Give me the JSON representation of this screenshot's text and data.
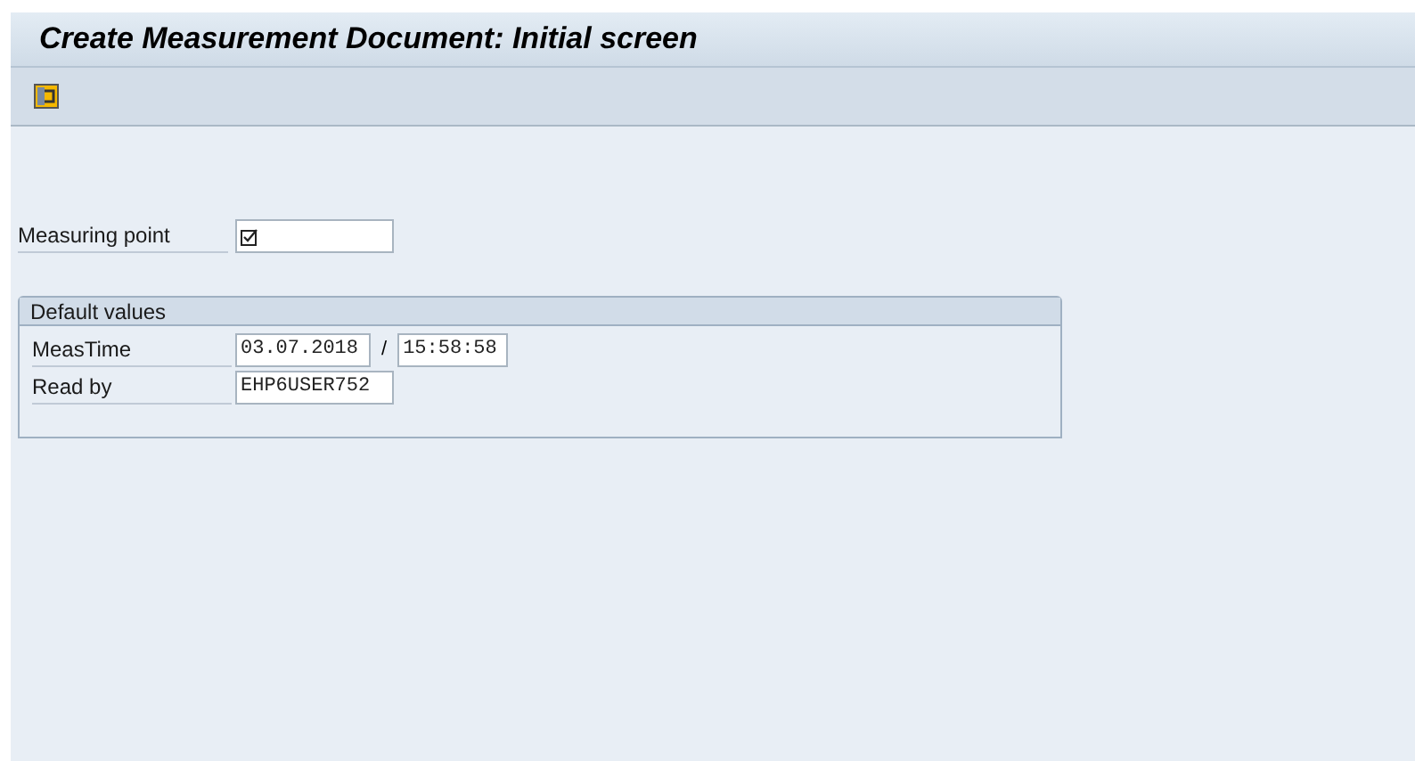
{
  "window": {
    "title": "Create Measurement Document: Initial screen"
  },
  "measuring_point": {
    "label": "Measuring point",
    "required": true
  },
  "default_values": {
    "title": "Default values",
    "meas_time": {
      "label": "MeasTime",
      "date": "03.07.2018",
      "separator": "/",
      "time": "15:58:58"
    },
    "read_by": {
      "label": "Read by",
      "value": "EHP6USER752"
    }
  }
}
